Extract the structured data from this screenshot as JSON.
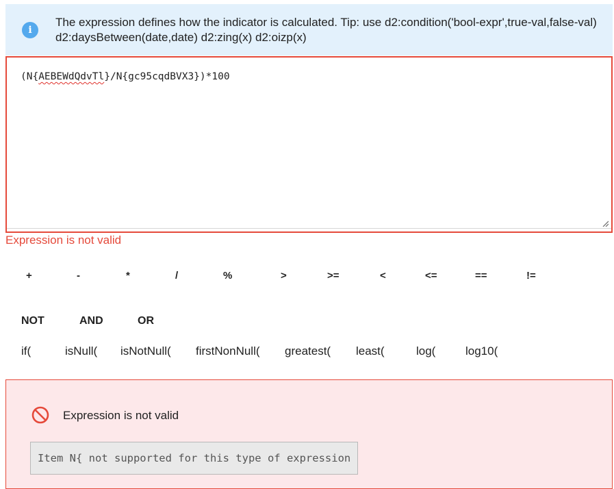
{
  "tip": {
    "icon": "info-icon",
    "text": "The expression defines how the indicator is calculated. Tip: use d2:condition('bool-expr',true-val,false-val) d2:daysBetween(date,date) d2:zing(x) d2:oizp(x)"
  },
  "editor": {
    "expression_parts": [
      "(N{",
      "AEBEWdQdvTl",
      "}/N{gc95cqdBVX3})*100"
    ]
  },
  "validation": {
    "inline_error": "Expression is not valid"
  },
  "operators": [
    "+",
    "-",
    "*",
    "/",
    "%",
    ">",
    ">=",
    "<",
    "<=",
    "==",
    "!="
  ],
  "logical": [
    "NOT",
    "AND",
    "OR"
  ],
  "functions": [
    "if(",
    "isNull(",
    "isNotNull(",
    "firstNonNull(",
    "greatest(",
    "least(",
    "log(",
    "log10("
  ],
  "error_box": {
    "icon": "error-circle-icon",
    "title": "Expression is not valid",
    "detail": "Item N{ not supported for this type of expression"
  },
  "colors": {
    "error": "#e5493a",
    "tip_background": "#e3f1fc",
    "info_icon": "#54a9ed",
    "error_background": "#fde8ea"
  }
}
